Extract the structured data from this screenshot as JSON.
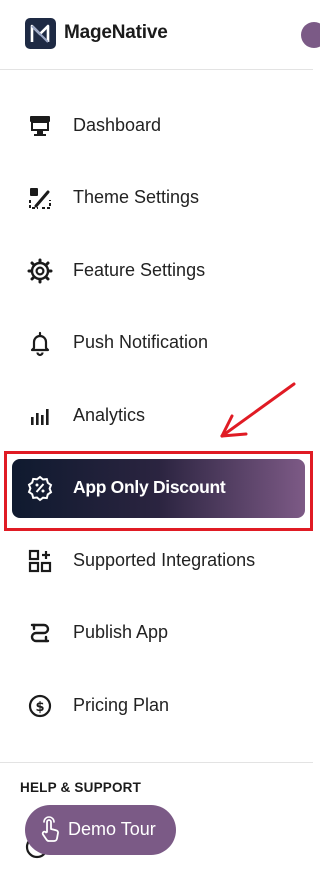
{
  "header": {
    "brand": "MageNative",
    "logo_icon": "magenative-logo-icon"
  },
  "nav": {
    "items": [
      {
        "label": "Dashboard",
        "icon": "storefront-icon"
      },
      {
        "label": "Theme Settings",
        "icon": "theme-brush-icon"
      },
      {
        "label": "Feature Settings",
        "icon": "gear-icon"
      },
      {
        "label": "Push Notification",
        "icon": "bell-icon"
      },
      {
        "label": "Analytics",
        "icon": "bar-chart-icon"
      },
      {
        "label": "App Only Discount",
        "icon": "discount-badge-icon",
        "active": true
      },
      {
        "label": "Supported Integrations",
        "icon": "integrations-grid-icon"
      },
      {
        "label": "Publish App",
        "icon": "publish-icon"
      },
      {
        "label": "Pricing Plan",
        "icon": "dollar-circle-icon"
      }
    ]
  },
  "help": {
    "title": "HELP & SUPPORT"
  },
  "demo": {
    "label": "Demo Tour",
    "icon": "pointer-hand-icon"
  },
  "annotation": {
    "highlight_color": "#e01b24"
  },
  "colors": {
    "accent": "#7b5a86",
    "active_start": "#0f1a2f",
    "active_end": "#7d5a86"
  }
}
